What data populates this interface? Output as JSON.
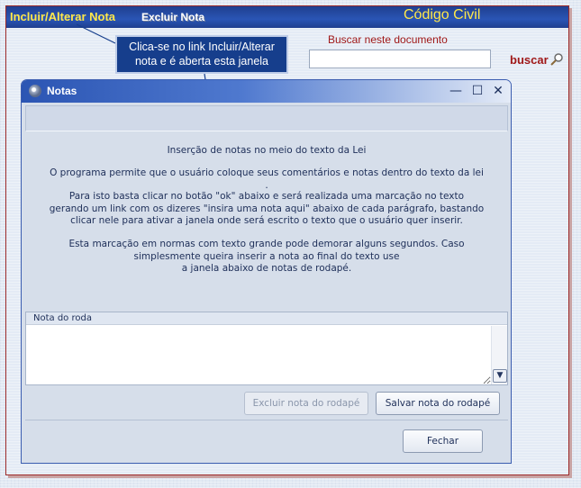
{
  "page": {
    "incluir_link": "Incluir/Alterar Nota",
    "excluir_link": "Excluir Nota",
    "app_title": "Código Civil",
    "search_label": "Buscar neste documento",
    "search_value": "",
    "search_button": "buscar"
  },
  "callout": {
    "line1": "Clica-se no link Incluir/Alterar",
    "line2": "nota e é aberta esta janela"
  },
  "dialog": {
    "title": "Notas",
    "heading": "Inserção de notas no meio do texto da Lei",
    "p1_line1": "O programa permite que o usuário coloque seus comentários e notas dentro do texto da lei",
    "p1_line2": ".",
    "p2_line1": "Para isto basta clicar no botão \"ok\" abaixo e será realizada uma marcação no texto",
    "p2_line2": "gerando um link com os dizeres \"insira uma nota aqui\" abaixo de cada parágrafo, bastando",
    "p2_line3": "clicar nele para ativar a janela onde será escrito o texto que o usuário quer inserir.",
    "p3_line1": "Esta marcação em normas com texto grande pode demorar alguns segundos. Caso",
    "p3_line2": "simplesmente queira inserir a nota ao final do texto use",
    "p3_line3": "a janela abaixo de notas de rodapé.",
    "footnote_label": "Nota do roda",
    "footnote_value": "",
    "btn_excluir": "Excluir nota do rodapé",
    "btn_salvar": "Salvar nota do rodapé",
    "btn_fechar": "Fechar"
  },
  "colors": {
    "topbar": "#2a55b5",
    "link_yellow": "#ffe84a",
    "search_red": "#a01818",
    "callout_bg": "#163e8c"
  }
}
